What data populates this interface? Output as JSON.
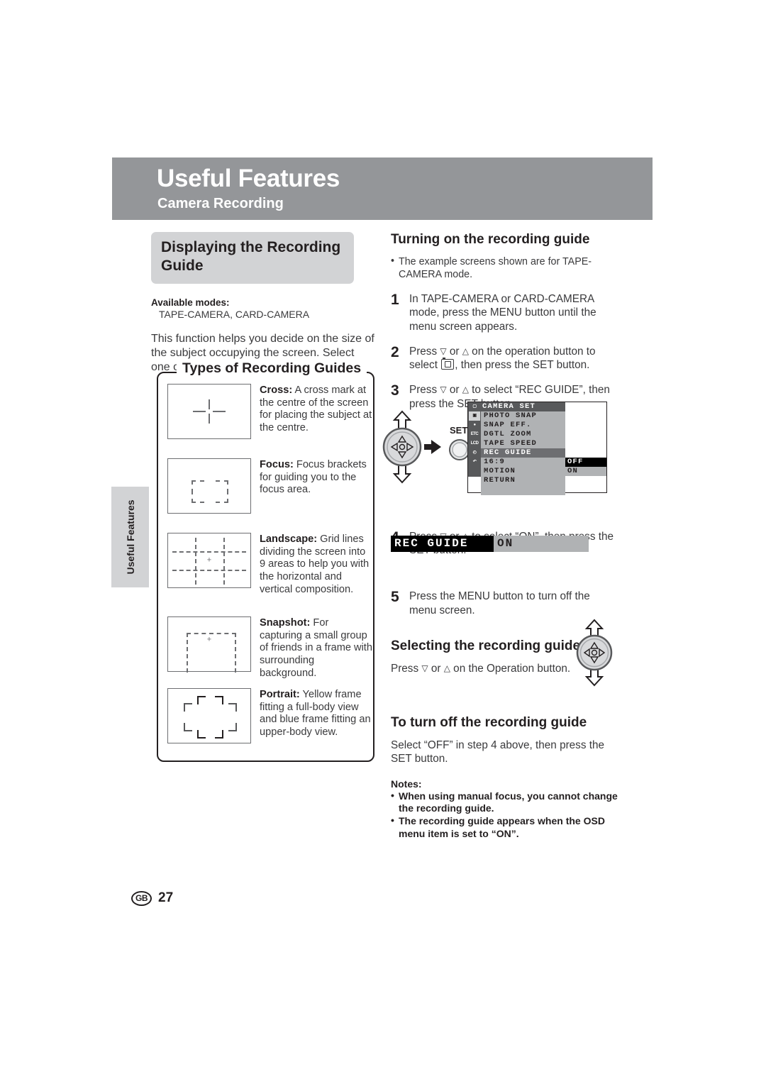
{
  "header": {
    "title": "Useful Features",
    "subtitle": "Camera Recording"
  },
  "side_tab": {
    "label": "Useful Features"
  },
  "footer": {
    "region_code": "GB",
    "page_number": "27"
  },
  "left_column": {
    "section_heading": "Displaying the Recording Guide",
    "available_modes_label": "Available modes:",
    "available_modes_value": "TAPE-CAMERA, CARD-CAMERA",
    "intro_paragraph": "This function helps you decide on the size of the subject occupying the screen. Select one of five recording guides.",
    "types_box_legend": "Types of Recording Guides",
    "guide_types": [
      {
        "name": "Cross:",
        "description": " A cross mark at the centre of the screen for placing the subject at the centre.",
        "thumb": "cross-guide-thumbnail"
      },
      {
        "name": "Focus:",
        "description": " Focus brackets for guiding you to the focus area.",
        "thumb": "focus-guide-thumbnail"
      },
      {
        "name": "Landscape:",
        "description": " Grid lines dividing the screen into 9 areas to help you with the horizontal and vertical composition.",
        "thumb": "landscape-guide-thumbnail"
      },
      {
        "name": "Snapshot:",
        "description": " For capturing a small group of friends in a frame with surrounding background.",
        "thumb": "snapshot-guide-thumbnail"
      },
      {
        "name": "Portrait:",
        "description": " Yellow frame fitting a full-body view and blue frame fitting an upper-body view.",
        "thumb": "portrait-guide-thumbnail"
      }
    ]
  },
  "right_column": {
    "heading_turning_on": "Turning on the recording guide",
    "note_example_screens": "The example screens shown are for TAPE-CAMERA mode.",
    "steps": [
      {
        "num": "1",
        "text_parts": [
          "In TAPE-CAMERA or CARD-CAMERA mode, press the MENU button until the menu screen appears."
        ]
      },
      {
        "num": "2",
        "pre": "Press ",
        "mid": " or ",
        "post": " on the operation button to select ",
        "tail": ", then press the SET button."
      },
      {
        "num": "3",
        "pre": "Press ",
        "mid": " or ",
        "post": " to select “REC GUIDE”, then press the SET button."
      },
      {
        "num": "4",
        "pre": "Press ",
        "mid": " or ",
        "post": " to select “ON”, then press the SET button."
      },
      {
        "num": "5",
        "text_parts": [
          "Press the MENU button to turn off the menu screen."
        ]
      }
    ],
    "set_button_label": "SET",
    "heading_selecting": "Selecting the recording guide",
    "selecting_pre": "Press ",
    "selecting_mid": " or ",
    "selecting_post": " on the Operation button.",
    "heading_turn_off": "To turn off the recording guide",
    "turn_off_text": "Select “OFF” in step 4 above, then press the SET button.",
    "notes_title": "Notes:",
    "notes": [
      "When using manual focus, you cannot change the recording guide.",
      "The recording guide appears when the OSD menu item is set to “ON”."
    ]
  },
  "osd_menu": {
    "title": "CAMERA SET",
    "icons": [
      "",
      "",
      "",
      "ETC",
      "LCD",
      "",
      ""
    ],
    "items": [
      {
        "label": "PHOTO SNAP",
        "highlighted": false
      },
      {
        "label": "SNAP EFF.",
        "highlighted": false
      },
      {
        "label": "DGTL ZOOM",
        "highlighted": false
      },
      {
        "label": "TAPE SPEED",
        "highlighted": false
      },
      {
        "label": "REC GUIDE",
        "highlighted": true
      },
      {
        "label": "16:9",
        "highlighted": false
      },
      {
        "label": "MOTION",
        "highlighted": false
      },
      {
        "label": "RETURN",
        "highlighted": false
      }
    ],
    "submenu": [
      {
        "label": "OFF",
        "selected": true
      },
      {
        "label": "ON",
        "selected": false
      }
    ]
  },
  "rec_banner": {
    "label": "REC GUIDE",
    "value": "ON"
  },
  "colors": {
    "header_gray": "#949699",
    "panel_gray": "#d2d3d5",
    "osd_list_gray": "#b0b2b4",
    "osd_dark": "#58595b",
    "text": "#231f20"
  }
}
